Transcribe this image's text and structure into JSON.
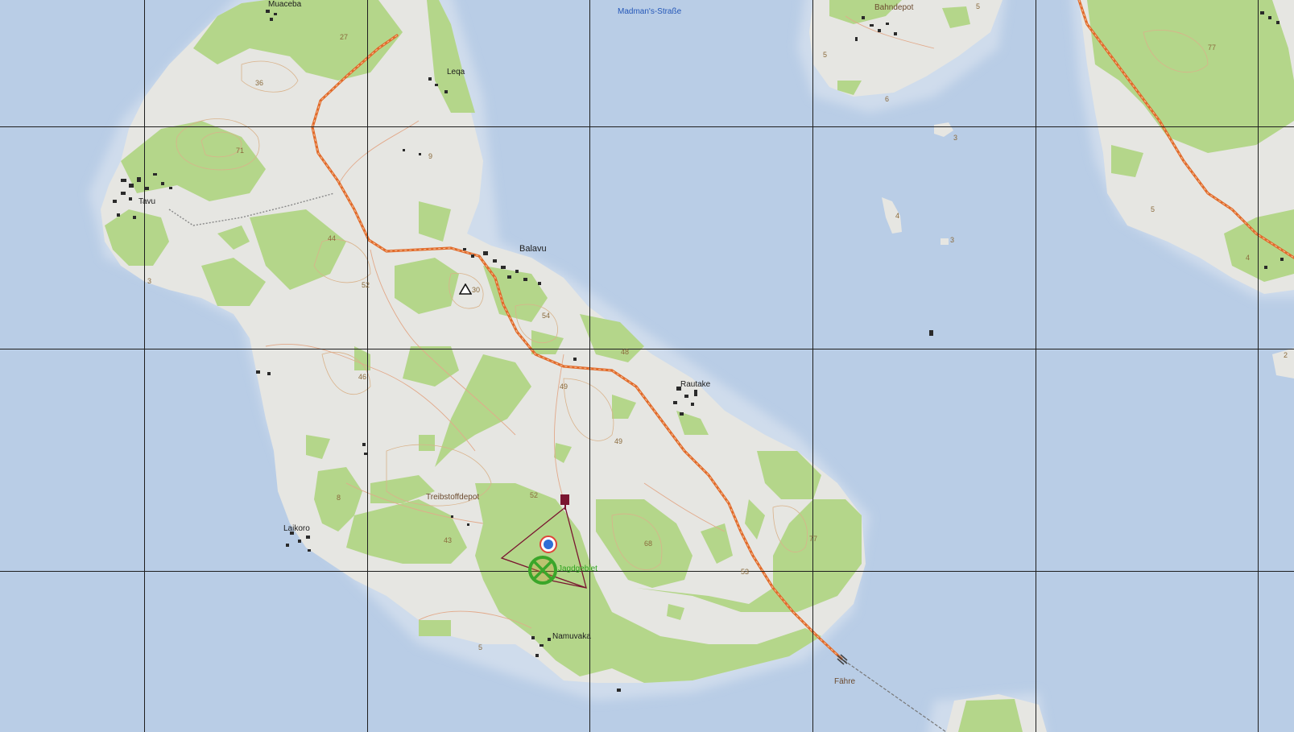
{
  "map": {
    "colors": {
      "water": "#b9cde6",
      "land": "#e6e6e2",
      "forest": "#b4d68a",
      "road": "#e06a2a",
      "grid": "#1e1e1e",
      "hunt_zone": "#7a1530",
      "hunt_marker": "#3aa62a"
    },
    "towns": {
      "muaceba": "Muaceba",
      "leqa": "Leqa",
      "tavu": "Tavu",
      "balavu": "Balavu",
      "rautake": "Rautake",
      "laikoro": "Laikoro",
      "namuvaka": "Namuvaka",
      "bahndepot": "Bahndepot",
      "fahre": "Fähre",
      "treibstoffdepot": "Treibstoffdepot"
    },
    "street": "Madman's-Straße",
    "hunt_label": "Jagdgebiet",
    "elevations": {
      "e27": "27",
      "e36": "36",
      "e71": "71",
      "e9": "9",
      "e44": "44",
      "e52a": "52",
      "e30": "30",
      "e54": "54",
      "e48": "48",
      "e49a": "49",
      "e46": "46",
      "e49b": "49",
      "e8": "8",
      "e52b": "52",
      "e43": "43",
      "e68": "68",
      "e53": "53",
      "e77a": "77",
      "e5a": "5",
      "e3a": "3",
      "e5b": "5",
      "e6": "6",
      "e3b": "3",
      "e4a": "4",
      "e3c": "3",
      "e77b": "77",
      "e5c": "5",
      "e4b": "4",
      "e2": "2",
      "e5d": "5"
    },
    "icons": {
      "mountain": "mountain-peak-icon",
      "target": "blue-target-icon",
      "crossed_circle": "hunting-zone-icon",
      "flag": "location-flag-icon"
    }
  }
}
